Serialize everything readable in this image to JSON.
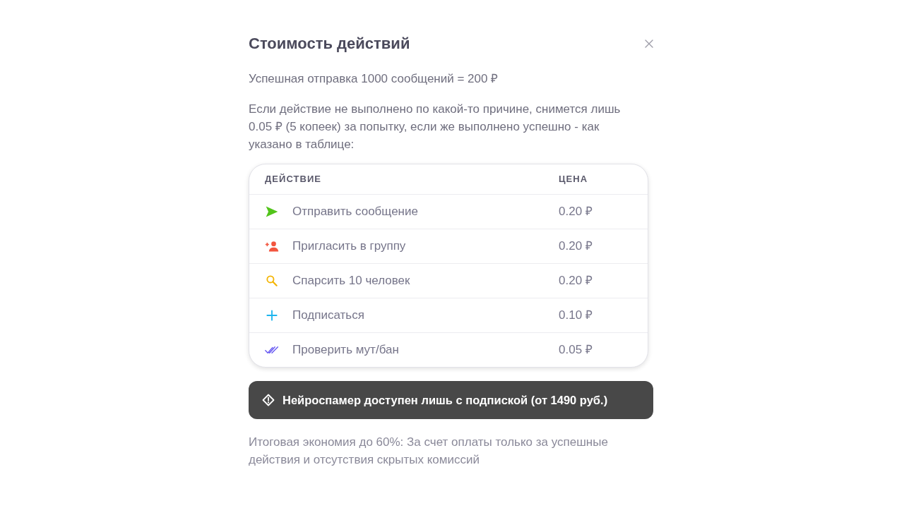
{
  "dialog": {
    "title": "Стоимость действий",
    "paragraphs": [
      "Успешная отправка 1000 сообщений = 200 ₽",
      "Если действие не выполнено по какой-то причине, снимется лишь 0.05 ₽ (5 копеек) за попытку, если же выполнено успешно - как указано в таблице:"
    ],
    "table": {
      "columns": [
        "ДЕЙСТВИЕ",
        "ЦЕНА"
      ],
      "rows": [
        {
          "kind": "send",
          "action": "Отправить сообщение",
          "price": "0.20 ₽"
        },
        {
          "kind": "invite",
          "action": "Пригласить в группу",
          "price": "0.20 ₽"
        },
        {
          "kind": "parse",
          "action": "Спарсить 10 человек",
          "price": "0.20 ₽"
        },
        {
          "kind": "subscribe",
          "action": "Подписаться",
          "price": "0.10 ₽"
        },
        {
          "kind": "check",
          "action": "Проверить мут/бан",
          "price": "0.05 ₽"
        }
      ]
    },
    "notice": "Нейроспамер доступен лишь с подпиской (от 1490 руб.)",
    "footer": "Итоговая экономия до 60%: За счет оплаты только за успешные действия и отсутствия скрытых комиссий"
  }
}
